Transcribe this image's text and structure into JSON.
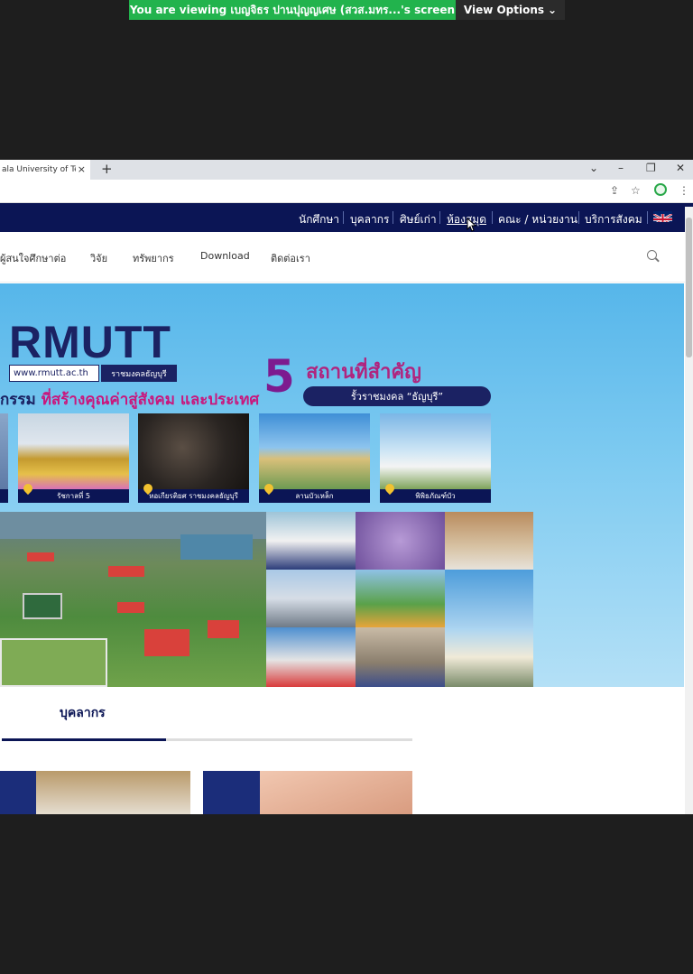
{
  "zoom": {
    "banner_text": "You are viewing เบญจิธร ปานปุญญเศษ (สวส.มทร...'s screen",
    "view_options": "View Options",
    "chevron_icon": "chevron-down-icon"
  },
  "browser": {
    "tab_title": "ala University of Techn",
    "tab_close": "×",
    "new_tab": "+",
    "window_controls": {
      "dropdown": "⌄",
      "minimize": "–",
      "restore": "❐",
      "close": "✕"
    },
    "toolbar_icons": [
      "share-icon",
      "star-icon",
      "extension-icon",
      "menu-icon"
    ]
  },
  "site": {
    "top_nav": [
      "นักศึกษา",
      "บุคลากร",
      "ศิษย์เก่า",
      "ห้องสมุด",
      "คณะ / หน่วยงาน",
      "บริการสังคม"
    ],
    "active_top_nav": "ห้องสมุด",
    "main_nav": [
      "ผู้สนใจศึกษาต่อ",
      "วิจัย",
      "ทรัพยากร",
      "Download",
      "ติดต่อเรา"
    ],
    "hero": {
      "logo": "RMUTT",
      "url": "www.rmutt.ac.th",
      "url_sub": "ราชมงคลธัญบุรี",
      "slogan_part1": "กรรม ",
      "slogan_part2": "ที่สร้างคุณค่าสู่สังคม และประเทศ",
      "five": "5",
      "places_title": "สถานที่สำคัญ",
      "places_sub": "รั้วราชมงคล “ธัญบุรี”",
      "places": [
        "รัชกาลที่ 5",
        "หอเกียรติยศ ราชมงคลธัญบุรี",
        "ลานบัวเหล็ก",
        "พิพิธภัณฑ์บัว"
      ]
    },
    "section_title": "บุคลากร",
    "carousel_progress": 0.4
  },
  "colors": {
    "navy": "#0b1555",
    "zoom_green": "#22b34d"
  }
}
